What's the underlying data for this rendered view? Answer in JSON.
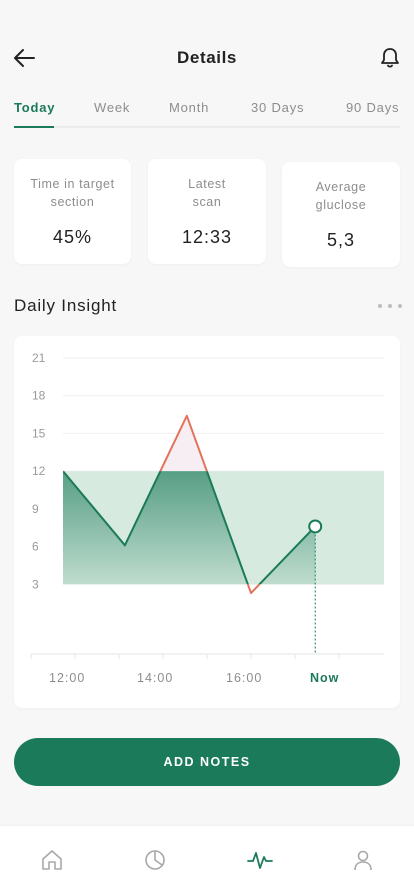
{
  "header": {
    "title": "Details",
    "back_icon": "arrow-left-icon",
    "bell_icon": "bell-icon"
  },
  "tabs": [
    {
      "label": "Today",
      "active": true
    },
    {
      "label": "Week",
      "active": false
    },
    {
      "label": "Month",
      "active": false
    },
    {
      "label": "30 Days",
      "active": false
    },
    {
      "label": "90 Days",
      "active": false
    }
  ],
  "stats": [
    {
      "label_lines": [
        "Time in target",
        "section"
      ],
      "value": "45%"
    },
    {
      "label_lines": [
        "Latest",
        "scan"
      ],
      "value": "12:33"
    },
    {
      "label_lines": [
        "Average",
        "gluclose"
      ],
      "value": "5,3"
    }
  ],
  "insight": {
    "title": "Daily Insight",
    "more_icon": "more-horizontal-icon"
  },
  "chart_data": {
    "type": "area",
    "title": "",
    "xlabel": "",
    "ylabel": "",
    "y_ticks": [
      "21",
      "18",
      "15",
      "12",
      "9",
      "6",
      "3"
    ],
    "ylim": [
      0,
      21
    ],
    "x_ticks": [
      "12:00",
      "14:00",
      "16:00",
      "Now"
    ],
    "target_range": [
      3,
      12
    ],
    "x_range": [
      12.0,
      19.0
    ],
    "series": [
      {
        "values": [
          {
            "x": 12.0,
            "y": 12
          },
          {
            "x": 13.35,
            "y": 6.1
          },
          {
            "x": 14.7,
            "y": 16.4
          },
          {
            "x": 16.1,
            "y": 2.3
          },
          {
            "x": 17.5,
            "y": 7.6
          }
        ]
      }
    ],
    "grid": true,
    "colors": {
      "in_range": "#1b7a5a",
      "out_of_range": "#e2735b",
      "target_band": "#d6eadf"
    }
  },
  "actions": {
    "add_notes_label": "ADD NOTES"
  },
  "bottom_nav": [
    {
      "icon": "home-icon",
      "active": false
    },
    {
      "icon": "pie-chart-icon",
      "active": false
    },
    {
      "icon": "activity-icon",
      "active": true
    },
    {
      "icon": "user-icon",
      "active": false
    }
  ],
  "colors": {
    "accent": "#1b7a5a",
    "muted": "#8d8d8d",
    "background": "#f7f7f7"
  }
}
